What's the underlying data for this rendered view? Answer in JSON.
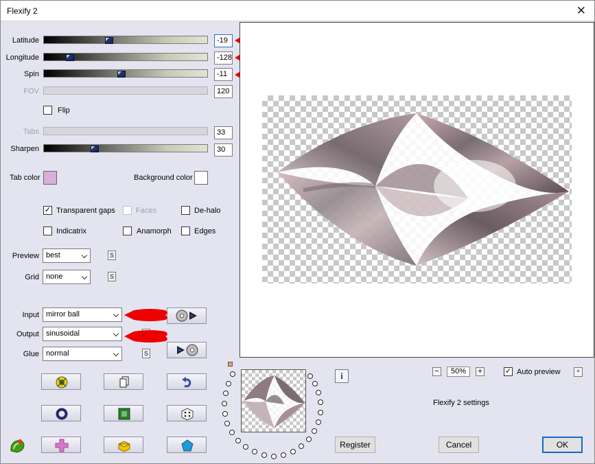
{
  "window": {
    "title": "Flexify 2",
    "close_glyph": "✕"
  },
  "sliders": [
    {
      "key": "latitude",
      "label": "Latitude",
      "value": "-19",
      "enabled": true,
      "level": 0.4
    },
    {
      "key": "longitude",
      "label": "Longitude",
      "value": "-128",
      "enabled": true,
      "level": 0.15
    },
    {
      "key": "spin",
      "label": "Spin",
      "value": "-11",
      "enabled": true,
      "level": 0.47
    },
    {
      "key": "fov",
      "label": "FOV",
      "value": "120",
      "enabled": false,
      "level": null
    },
    {
      "key": "tabs",
      "label": "Tabs",
      "value": "33",
      "enabled": false,
      "level": null
    },
    {
      "key": "sharpen",
      "label": "Sharpen",
      "value": "30",
      "enabled": true,
      "level": 0.3
    }
  ],
  "flip": {
    "label": "Flip",
    "checked": false
  },
  "colors": {
    "tab_label": "Tab color",
    "tab_color": "#d9aed9",
    "bg_label": "Background color",
    "bg_color": "#ffffff"
  },
  "options": {
    "transparent_gaps": {
      "label": "Transparent gaps",
      "checked": true,
      "mark": "✓"
    },
    "faces": {
      "label": "Faces",
      "checked": false,
      "enabled": false
    },
    "de_halo": {
      "label": "De-halo",
      "checked": false
    },
    "indicatrix": {
      "label": "Indicatrix",
      "checked": false
    },
    "anamorph": {
      "label": "Anamorph",
      "checked": false
    },
    "edges": {
      "label": "Edges",
      "checked": false
    }
  },
  "dropdowns": {
    "preview": {
      "label": "Preview",
      "value": "best"
    },
    "grid": {
      "label": "Grid",
      "value": "none"
    },
    "input": {
      "label": "Input",
      "value": "mirror ball"
    },
    "output": {
      "label": "Output",
      "value": "sinusoidal"
    },
    "glue": {
      "label": "Glue",
      "value": "normal"
    }
  },
  "s_button_label": "S",
  "zoom": {
    "minus": "−",
    "value": "50%",
    "plus": "+"
  },
  "auto_preview": {
    "label": "Auto preview",
    "checked": true,
    "mark": "✓",
    "toggle": "^"
  },
  "info_glyph": "i",
  "settings_label": "Flexify 2 settings",
  "buttons": {
    "register": "Register",
    "cancel": "Cancel",
    "ok": "OK"
  },
  "accent_colors": {
    "arrow_red": "#ee0000",
    "thumb_navy": "#1a2a60",
    "default_btn_border": "#0f6cc4"
  },
  "icons": {
    "input_media": "disc-play-icon",
    "output_media": "play-disc-icon",
    "row1": [
      "randomize-icon",
      "copy-icon",
      "undo-icon"
    ],
    "row2": [
      "circle-icon",
      "square-icon",
      "dice-icon"
    ],
    "row3": [
      "plus-icon",
      "cube-icon",
      "pentagon-icon"
    ],
    "logo": "plugin-logo-icon"
  }
}
